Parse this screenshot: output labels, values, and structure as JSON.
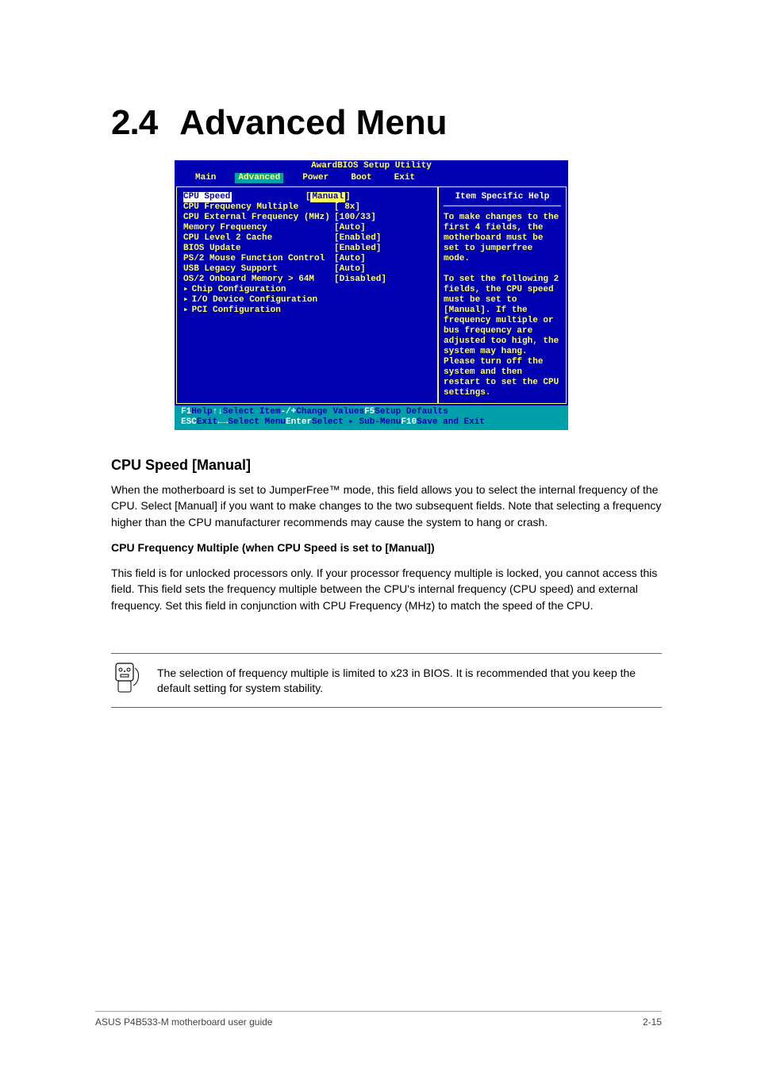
{
  "page": {
    "heading_number": "2.4",
    "heading_title": "Advanced Menu"
  },
  "bios": {
    "title": "AwardBIOS Setup Utility",
    "menu": [
      "Main",
      "Advanced",
      "Power",
      "Boot",
      "Exit"
    ],
    "menu_selected": "Advanced",
    "settings": [
      {
        "label": "CPU Speed",
        "value": "Manual",
        "highlight": true
      },
      {
        "label": "CPU Frequency Multiple",
        "value": "[ 8x]"
      },
      {
        "label": "CPU External Frequency (MHz)",
        "value": "[100/33]"
      },
      {
        "label": "Memory Frequency",
        "value": "[Auto]"
      },
      {
        "label": "CPU Level 2 Cache",
        "value": "[Enabled]"
      },
      {
        "label": "BIOS Update",
        "value": "[Enabled]"
      },
      {
        "label": "PS/2 Mouse Function Control",
        "value": "[Auto]"
      },
      {
        "label": "USB Legacy Support",
        "value": "[Auto]"
      },
      {
        "label": "OS/2 Onboard Memory > 64M",
        "value": "[Disabled]"
      }
    ],
    "submenus": [
      "Chip Configuration",
      "I/O Device Configuration",
      "PCI Configuration"
    ],
    "help": {
      "title": "Item Specific Help",
      "text": "To make changes to the first 4 fields, the motherboard must be set to jumperfree mode.\n\nTo set the following 2 fields, the CPU speed must be set to [Manual]. If the frequency multiple or bus frequency are adjusted too high, the system may hang. Please turn off the system and then restart to set the CPU settings."
    },
    "footer": {
      "pairs_row1": [
        {
          "k": "F1",
          "v": "Help"
        },
        {
          "k": "↑↓",
          "v": "Select Item"
        },
        {
          "k": "-/+",
          "v": "Change Values"
        },
        {
          "k": "F5",
          "v": "Setup Defaults"
        }
      ],
      "pairs_row2": [
        {
          "k": "ESC",
          "v": "Exit"
        },
        {
          "k": "←→",
          "v": "Select Menu"
        },
        {
          "k": "Enter",
          "v": "Select ▸ Sub-Menu"
        },
        {
          "k": "F10",
          "v": "Save and Exit"
        }
      ]
    }
  },
  "sections": {
    "cpu_speed": {
      "title": "CPU Speed [Manual]",
      "p1": "When the motherboard is set to JumperFree™ mode, this field allows you to select the internal frequency of the CPU. Select [Manual] if you want to make changes to the two subsequent fields. Note that selecting a frequency higher than the CPU manufacturer recommends may cause the system to hang or crash.",
      "p2": "CPU Frequency Multiple (when CPU Speed is set to [Manual])",
      "p3": "This field is for unlocked processors only. If your processor frequency multiple is locked, you cannot access this field. This field sets the frequency multiple between the CPU's internal frequency (CPU speed) and external frequency. Set this field in conjunction with CPU Frequency (MHz) to match the speed of the CPU."
    },
    "note": "The selection of frequency multiple is limited to x23 in BIOS. It is recommended that you keep the default setting for system stability."
  },
  "footer": {
    "left": "ASUS P4B533-M motherboard user guide",
    "right": "2-15"
  }
}
